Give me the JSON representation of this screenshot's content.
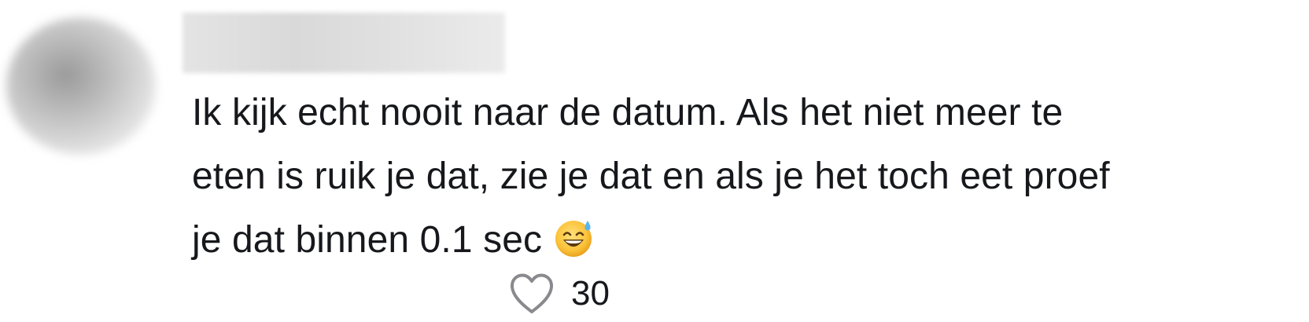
{
  "comment": {
    "text": "Ik kijk echt nooit naar de datum. Als het niet meer te\neten is ruik je dat, zie je dat en als je het toch eet proef\nje dat binnen 0.1 sec",
    "emoji": "grinning-face-with-sweat-icon"
  },
  "likes": {
    "count": "30",
    "icon": "heart-outline-icon"
  },
  "colors": {
    "text": "#16181c",
    "icon_stroke": "#8a8a8e"
  }
}
